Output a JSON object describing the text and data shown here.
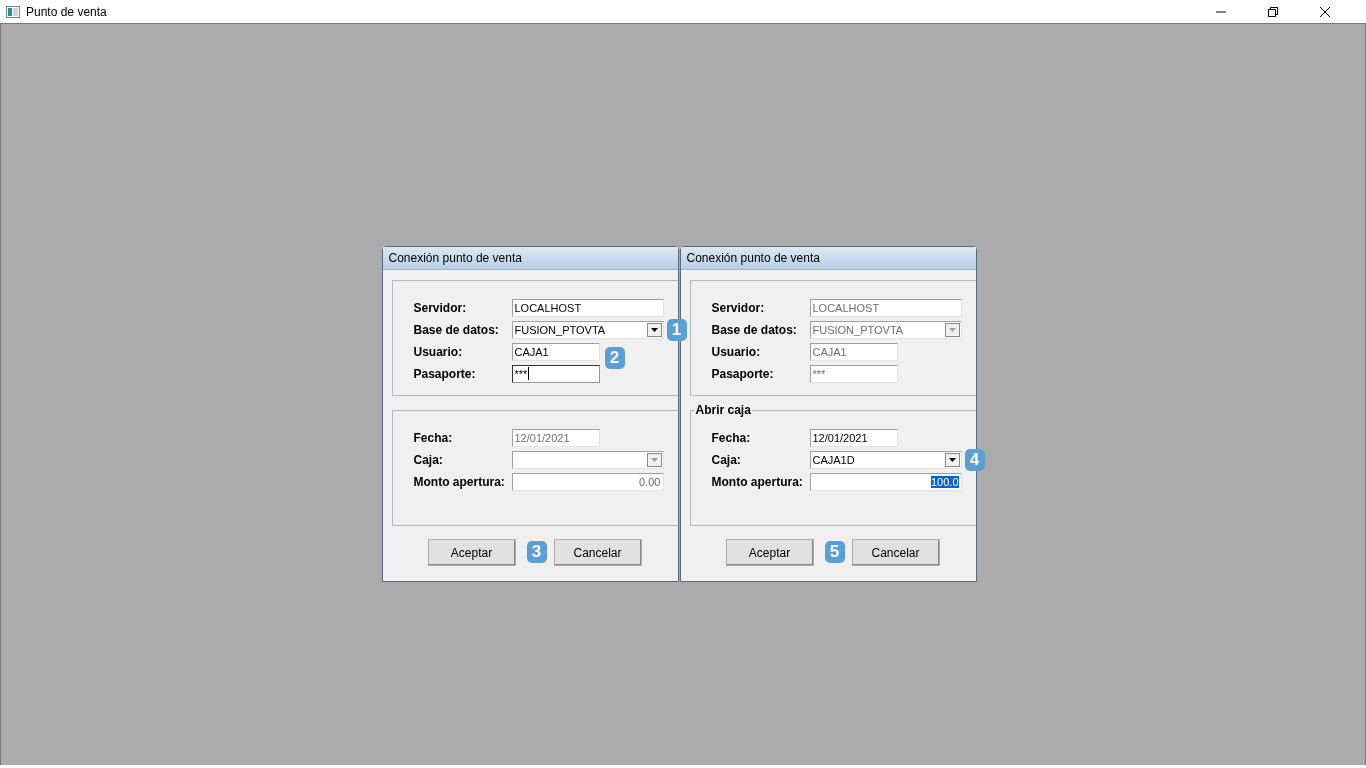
{
  "window": {
    "title": "Punto de venta"
  },
  "dialogs": [
    {
      "title": "Conexión punto de venta",
      "groups": [
        {
          "fields": [
            {
              "label": "Servidor:",
              "value": "LOCALHOST",
              "kind": "text",
              "disabled": false,
              "focused": false,
              "highlighted": false
            },
            {
              "label": "Base de datos:",
              "value": "FUSION_PTOVTA",
              "kind": "combo",
              "disabled": false,
              "focused": false,
              "highlighted": false,
              "badge": "1"
            },
            {
              "label": "Usuario:",
              "value": "CAJA1",
              "kind": "short",
              "disabled": false,
              "focused": false,
              "highlighted": false,
              "badge": "2"
            },
            {
              "label": "Pasaporte:",
              "value": "***",
              "kind": "short",
              "disabled": false,
              "focused": true,
              "highlighted": false
            }
          ]
        },
        {
          "fields": [
            {
              "label": "Fecha:",
              "value": "12/01/2021",
              "kind": "short",
              "disabled": true,
              "focused": false,
              "highlighted": false
            },
            {
              "label": "Caja:",
              "kind": "combo",
              "disabled": true,
              "focused": false,
              "highlighted": false
            },
            {
              "label": "Monto apertura:",
              "value": "0.00",
              "kind": "number",
              "disabled": true,
              "focused": false,
              "highlighted": false
            }
          ]
        }
      ],
      "buttons": [
        "Aceptar",
        "Cancelar"
      ],
      "button_badge": "3"
    },
    {
      "title": "Conexión punto de venta",
      "groups": [
        {
          "fields": [
            {
              "label": "Servidor:",
              "value": "LOCALHOST",
              "kind": "text",
              "disabled": true,
              "focused": false,
              "highlighted": false
            },
            {
              "label": "Base de datos:",
              "value": "FUSION_PTOVTA",
              "kind": "combo",
              "disabled": true,
              "focused": false,
              "highlighted": false
            },
            {
              "label": "Usuario:",
              "value": "CAJA1",
              "kind": "short",
              "disabled": true,
              "focused": false,
              "highlighted": false
            },
            {
              "label": "Pasaporte:",
              "value": "***",
              "kind": "short",
              "disabled": true,
              "focused": false,
              "highlighted": false
            }
          ]
        },
        {
          "title": "Abrir caja",
          "fields": [
            {
              "label": "Fecha:",
              "value": "12/01/2021",
              "kind": "short",
              "disabled": false,
              "focused": false,
              "highlighted": false
            },
            {
              "label": "Caja:",
              "value": "CAJA1D",
              "kind": "combo",
              "disabled": false,
              "focused": false,
              "highlighted": false,
              "badge": "4"
            },
            {
              "label": "Monto apertura:",
              "value": "100.0",
              "kind": "number",
              "disabled": false,
              "focused": false,
              "highlighted": true
            }
          ]
        }
      ],
      "buttons": [
        "Aceptar",
        "Cancelar"
      ],
      "button_badge": "5"
    }
  ]
}
